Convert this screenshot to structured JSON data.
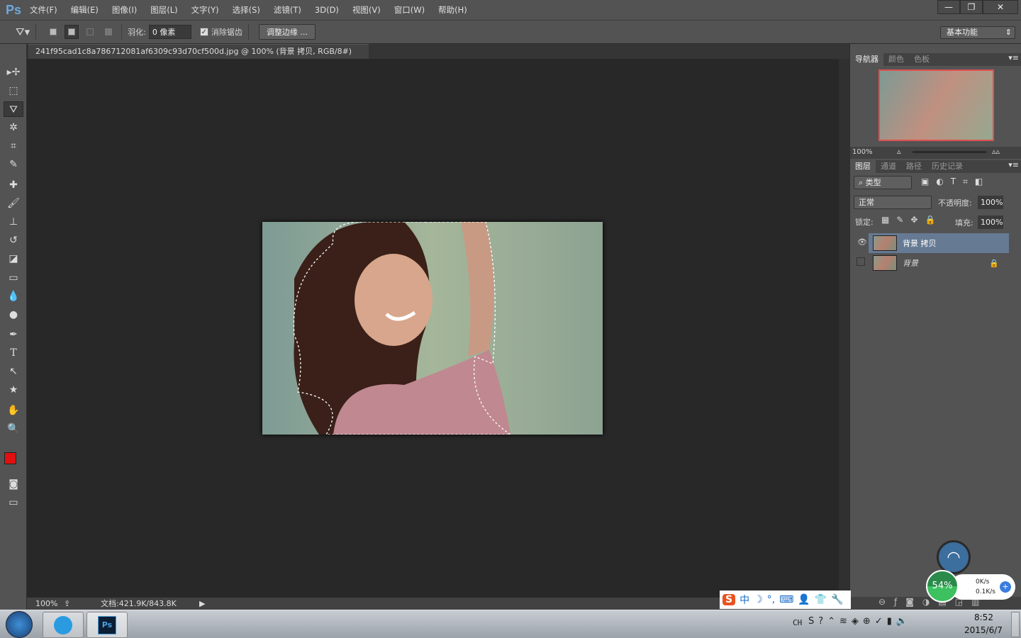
{
  "app": {
    "logo": "Ps",
    "menus": [
      "文件(F)",
      "编辑(E)",
      "图像(I)",
      "图层(L)",
      "文字(Y)",
      "选择(S)",
      "滤镜(T)",
      "3D(D)",
      "视图(V)",
      "窗口(W)",
      "帮助(H)"
    ],
    "window_buttons": {
      "minimize": "—",
      "restore": "❐",
      "close": "✕"
    }
  },
  "options": {
    "feather_label": "羽化:",
    "feather_value": "0 像素",
    "antialias_label": "消除锯齿",
    "antialias_checked": true,
    "refine_edge": "调整边缘 ...",
    "workspace": "基本功能"
  },
  "document": {
    "tab_title": "241f95cad1c8a786712081af6309c93d70cf500d.jpg @ 100% (背景 拷贝, RGB/8#) *",
    "tab_close": "×",
    "zoom": "100%",
    "doc_info": "文档:421.9K/843.8K"
  },
  "tools": [
    "move-tool",
    "rect-marquee-tool",
    "polygon-lasso-tool",
    "magic-wand-tool",
    "crop-tool",
    "eyedropper-tool",
    "healing-brush-tool",
    "brush-tool",
    "clone-stamp-tool",
    "history-brush-tool",
    "eraser-tool",
    "gradient-tool",
    "blur-tool",
    "dodge-tool",
    "pen-tool",
    "type-tool",
    "path-selection-tool",
    "shape-tool",
    "hand-tool",
    "zoom-tool"
  ],
  "colors": {
    "foreground": "#e01010",
    "background": "#ffffff",
    "accent_selected_layer": "#667a94"
  },
  "navigator": {
    "tabs": [
      "导航器",
      "颜色",
      "色板"
    ],
    "zoom": "100%"
  },
  "layers_panel": {
    "tabs": [
      "图层",
      "通道",
      "路径",
      "历史记录"
    ],
    "filter": "类型",
    "blend_mode": "正常",
    "opacity_label": "不透明度:",
    "opacity": "100%",
    "lock_label": "锁定:",
    "fill_label": "填充:",
    "fill": "100%",
    "layers": [
      {
        "name": "背景 拷贝",
        "visible": true,
        "selected": true
      },
      {
        "name": "背景",
        "visible": false,
        "locked": true
      }
    ]
  },
  "net_widget": {
    "percent": "54%",
    "up": "0K/s",
    "down": "0.1K/s"
  },
  "ime": {
    "mode": "中"
  },
  "taskbar": {
    "lang": "CH",
    "time": "8:52",
    "date": "2015/6/7"
  }
}
